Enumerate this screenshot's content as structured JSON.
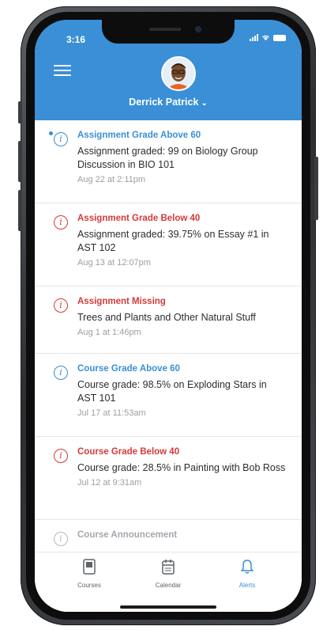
{
  "status": {
    "time": "3:16"
  },
  "header": {
    "user_name": "Derrick Patrick",
    "chevron": "⌄"
  },
  "alerts": [
    {
      "title": "Assignment Grade Above 60",
      "body": "Assignment graded: 99 on Biology Group Discussion in BIO 101",
      "time": "Aug 22 at 2:11pm",
      "color": "blue",
      "unread": true
    },
    {
      "title": "Assignment Grade Below 40",
      "body": "Assignment graded: 39.75% on Essay #1 in AST 102",
      "time": "Aug 13 at 12:07pm",
      "color": "red",
      "unread": false
    },
    {
      "title": "Assignment Missing",
      "body": "Trees and Plants and Other Natural Stuff",
      "time": "Aug 1 at 1:46pm",
      "color": "red",
      "unread": false
    },
    {
      "title": "Course Grade Above 60",
      "body": "Course grade: 98.5% on Exploding Stars in AST 101",
      "time": "Jul 17 at 11:53am",
      "color": "blue",
      "unread": false
    },
    {
      "title": "Course Grade Below 40",
      "body": "Course grade: 28.5% in Painting with Bob Ross",
      "time": "Jul 12 at 9:31am",
      "color": "red",
      "unread": false
    },
    {
      "title": "Course Announcement",
      "body": "",
      "time": "",
      "color": "gray",
      "unread": false
    }
  ],
  "tabs": [
    {
      "label": "Courses",
      "icon": "courses-icon",
      "active": false
    },
    {
      "label": "Calendar",
      "icon": "calendar-icon",
      "active": false
    },
    {
      "label": "Alerts",
      "icon": "bell-icon",
      "active": true
    }
  ],
  "colors": {
    "accent": "#3a8fd6",
    "alert_red": "#d43a3a",
    "muted": "#9aa0a6"
  }
}
